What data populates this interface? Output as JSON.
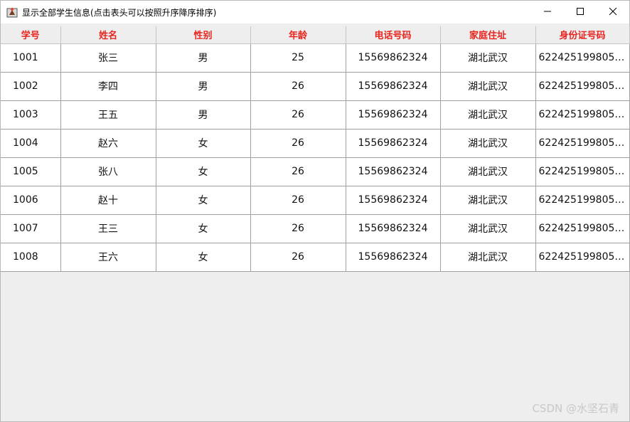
{
  "window": {
    "title": "显示全部学生信息(点击表头可以按照升序降序排序)",
    "controls": {
      "minimize": "minimize-icon",
      "maximize": "maximize-icon",
      "close": "close-icon"
    }
  },
  "table": {
    "header_color": "#e8251f",
    "columns": [
      "学号",
      "姓名",
      "性别",
      "年龄",
      "电话号码",
      "家庭住址",
      "身份证号码"
    ],
    "rows": [
      [
        "1001",
        "张三",
        "男",
        "25",
        "15569862324",
        "湖北武汉",
        "62242519980505..."
      ],
      [
        "1002",
        "李四",
        "男",
        "26",
        "15569862324",
        "湖北武汉",
        "62242519980505..."
      ],
      [
        "1003",
        "王五",
        "男",
        "26",
        "15569862324",
        "湖北武汉",
        "62242519980505..."
      ],
      [
        "1004",
        "赵六",
        "女",
        "26",
        "15569862324",
        "湖北武汉",
        "62242519980505..."
      ],
      [
        "1005",
        "张八",
        "女",
        "26",
        "15569862324",
        "湖北武汉",
        "62242519980505..."
      ],
      [
        "1006",
        "赵十",
        "女",
        "26",
        "15569862324",
        "湖北武汉",
        "62242519980505..."
      ],
      [
        "1007",
        "王三",
        "女",
        "26",
        "15569862324",
        "湖北武汉",
        "62242519980505..."
      ],
      [
        "1008",
        "王六",
        "女",
        "26",
        "15569862324",
        "湖北武汉",
        "62242519980505..."
      ]
    ]
  },
  "watermark": "CSDN @水坚石青"
}
